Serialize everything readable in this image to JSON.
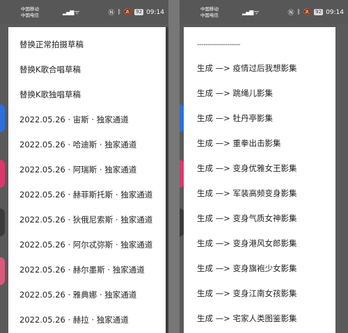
{
  "status_bar": {
    "carrier1": "中国移动",
    "carrier2": "中国电信",
    "battery": "92",
    "time": "09:14"
  },
  "left_menu": {
    "items": [
      "替换正常拍摄草稿",
      "替换K歌合唱草稿",
      "替换K歌独唱草稿",
      "2022.05.26 · 宙斯 · 独家通道",
      "2022.05.26 · 哈迪斯 · 独家通道",
      "2022.05.26 · 阿瑞斯 · 独家通道",
      "2022.05.26 · 赫菲斯托斯 · 独家通道",
      "2022.05.26 · 狄俄尼索斯 · 独家通道",
      "2022.05.26 · 阿尔忒弥斯 · 独家通道",
      "2022.05.26 · 赫尔墨斯 · 独家通道",
      "2022.05.26 · 雅典娜 · 独家通道",
      "2022.05.26 · 赫拉 · 独家通道"
    ]
  },
  "right_menu": {
    "divider": "--------------------",
    "items": [
      "生成 —> 疫情过后我想影集",
      "生成 —> 跳绳儿影集",
      "生成 —> 牡丹亭影集",
      "生成 —> 重拳出击影集",
      "生成 —> 变身优雅女王影集",
      "生成 —> 军装高频变身影集",
      "生成 —> 变身气质女神影集",
      "生成 —> 变身港风女郎影集",
      "生成 —> 变身旗袍少女影集",
      "生成 —> 变身江南女孩影集",
      "生成 —> 宅家人类图鉴影集"
    ]
  }
}
